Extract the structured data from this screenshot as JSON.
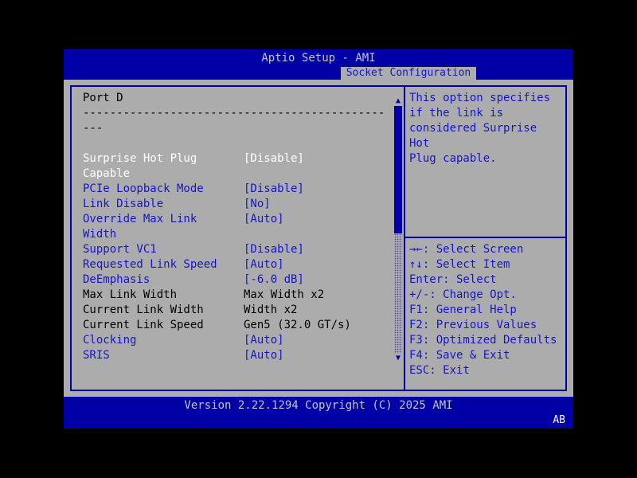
{
  "window": {
    "title": "Aptio Setup - AMI",
    "tab": "Socket Configuration",
    "footer_version": "Version 2.22.1294 Copyright (C) 2025 AMI",
    "footer_badge": "AB"
  },
  "colors": {
    "navy": "#0000A6",
    "gray": "#ACACAC",
    "blue_text": "#1616C8",
    "selected_text": "#FFFFFF",
    "silver": "#C6C6C6"
  },
  "main": {
    "items": [
      {
        "state": "readonly",
        "label": "Port D",
        "value": ""
      },
      {
        "state": "separator",
        "label": "---------------------------------------------\n---",
        "value": ""
      },
      {
        "state": "blank",
        "label": "",
        "value": ""
      },
      {
        "state": "selected",
        "label": "Surprise Hot Plug\nCapable",
        "value": "[Disable]"
      },
      {
        "state": "editable",
        "label": "PCIe Loopback Mode",
        "value": "[Disable]"
      },
      {
        "state": "editable",
        "label": "Link Disable",
        "value": "[No]"
      },
      {
        "state": "editable",
        "label": "Override Max Link\nWidth",
        "value": "[Auto]"
      },
      {
        "state": "editable",
        "label": "Support VC1",
        "value": "[Disable]"
      },
      {
        "state": "editable",
        "label": "Requested Link Speed",
        "value": "[Auto]"
      },
      {
        "state": "editable",
        "label": "DeEmphasis",
        "value": "[-6.0 dB]"
      },
      {
        "state": "readonly",
        "label": "Max Link Width",
        "value": "Max Width x2"
      },
      {
        "state": "readonly",
        "label": "Current Link Width",
        "value": "Width x2"
      },
      {
        "state": "readonly",
        "label": "Current Link Speed",
        "value": "Gen5 (32.0 GT/s)"
      },
      {
        "state": "editable",
        "label": "Clocking",
        "value": "[Auto]"
      },
      {
        "state": "editable",
        "label": "SRIS",
        "value": "[Auto]"
      }
    ]
  },
  "help": {
    "text": "This option specifies\nif the link is\nconsidered Surprise Hot\nPlug capable."
  },
  "hotkeys": [
    "→←: Select Screen",
    "↑↓: Select Item",
    "Enter: Select",
    "+/-: Change Opt.",
    "F1: General Help",
    "F2: Previous Values",
    "F3: Optimized Defaults",
    "F4: Save & Exit",
    "ESC: Exit"
  ],
  "scrollbar": {
    "up": "▲",
    "down": "▼"
  }
}
